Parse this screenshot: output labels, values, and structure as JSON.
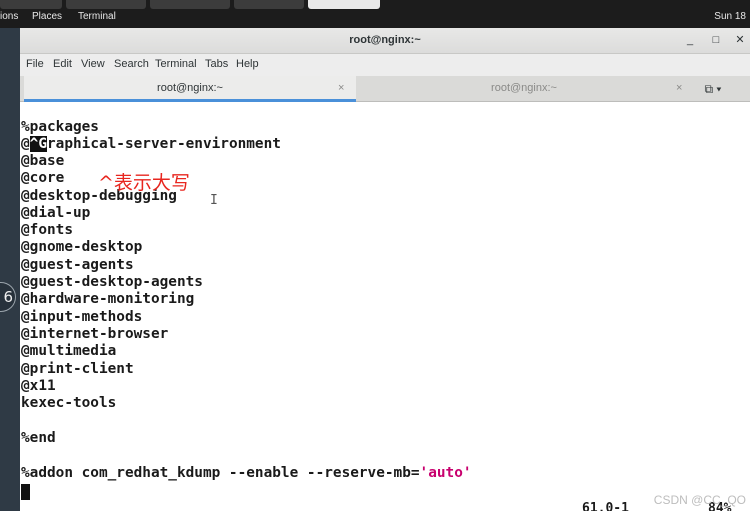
{
  "topbar": {
    "menu_apps": "ions",
    "menu_places": "Places",
    "menu_terminal": "Terminal",
    "clock": "Sun 18"
  },
  "desktop": {
    "icon_glyph": "6"
  },
  "window": {
    "title": "root@nginx:~",
    "minimize": "_",
    "maximize": "□",
    "close": "✕"
  },
  "menubar": {
    "file": "File",
    "edit": "Edit",
    "view": "View",
    "search": "Search",
    "terminal": "Terminal",
    "tabs": "Tabs",
    "help": "Help"
  },
  "tabs": [
    {
      "label": "root@nginx:~",
      "close": "×"
    },
    {
      "label": "root@nginx:~",
      "close": "×"
    }
  ],
  "tab_menu": "⧉ ▾",
  "terminal": {
    "lines": [
      "%packages",
      "@",
      "@base",
      "@core",
      "@desktop-debugging",
      "@dial-up",
      "@fonts",
      "@gnome-desktop",
      "@guest-agents",
      "@guest-desktop-agents",
      "@hardware-monitoring",
      "@input-methods",
      "@internet-browser",
      "@multimedia",
      "@print-client",
      "@x11",
      "kexec-tools",
      "",
      "%end",
      "",
      "%addon com_redhat_kdump --enable --reserve-mb="
    ],
    "line1_cursor": "^G",
    "line1_rest": "raphical-server-environment",
    "addon_value": "'auto'",
    "status_position": "61,0-1",
    "status_percent": "84%"
  },
  "annotation": "^表示大写",
  "watermark": "CSDN @CC_QO"
}
